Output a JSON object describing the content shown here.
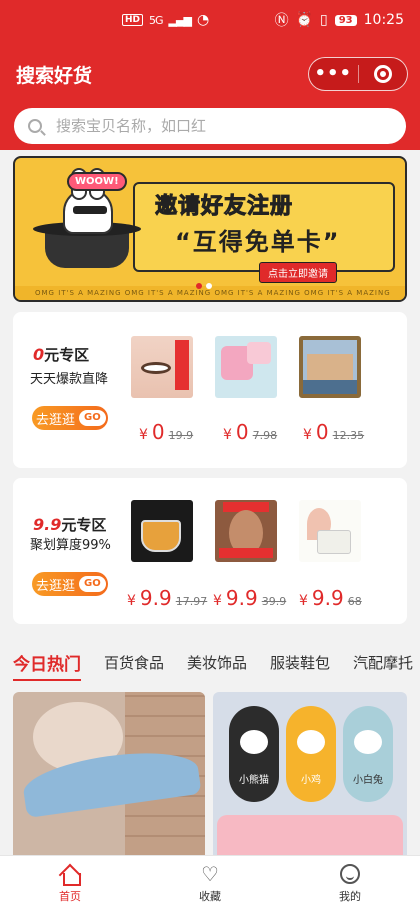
{
  "status_bar": {
    "hd": "HD",
    "network": "5G",
    "battery": "93",
    "time": "10:25"
  },
  "header": {
    "title": "搜索好货",
    "capsule_more": "•••"
  },
  "search": {
    "placeholder": "搜索宝贝名称，如口红"
  },
  "banner": {
    "badge": "WOOW!",
    "line1": "邀请好友注册",
    "line2": "“互得免单卡”",
    "button": "点击立即邀请",
    "strip": "OMG IT'S A MAZING   OMG IT'S A MAZING   OMG IT'S A MAZING   OMG IT'S A MAZING",
    "slide_count": 2,
    "active_slide": 1
  },
  "zero_zone": {
    "title_red": "0",
    "title": "元专区",
    "subtitle": "天天爆款直降",
    "button": "去逛逛",
    "button_badge": "GO",
    "products": [
      {
        "image": "eye-patch-product",
        "currency": "¥",
        "price": "0",
        "original": "19.9"
      },
      {
        "image": "pink-cosmetic-product",
        "currency": "¥",
        "price": "0",
        "original": "7.98"
      },
      {
        "image": "framed-painting-product",
        "currency": "¥",
        "price": "0",
        "original": "12.35"
      }
    ]
  },
  "nine_zone": {
    "title_red": "9.9",
    "title": "元专区",
    "subtitle": "聚划算度99%",
    "button": "去逛逛",
    "button_badge": "GO",
    "products": [
      {
        "image": "glass-tea-cup-product",
        "currency": "¥",
        "price": "9.9",
        "original": "17.97"
      },
      {
        "image": "face-skin-product",
        "currency": "¥",
        "price": "9.9",
        "original": "39.9"
      },
      {
        "image": "cream-jar-product",
        "currency": "¥",
        "price": "9.9",
        "original": "68"
      }
    ]
  },
  "tabs": [
    {
      "label": "今日热门",
      "active": true
    },
    {
      "label": "百货食品",
      "active": false
    },
    {
      "label": "美妆饰品",
      "active": false
    },
    {
      "label": "服装鞋包",
      "active": false
    },
    {
      "label": "汽配摩托",
      "active": false
    }
  ],
  "feed": {
    "item1": {
      "image": "child-shower-cap-photo"
    },
    "item2": {
      "image": "cartoon-cups-photo",
      "labels": [
        "小熊猫",
        "小鸡",
        "小白兔"
      ]
    }
  },
  "bottom_nav": [
    {
      "label": "首页",
      "icon": "home-icon",
      "active": true
    },
    {
      "label": "收藏",
      "icon": "heart-icon",
      "active": false
    },
    {
      "label": "我的",
      "icon": "user-icon",
      "active": false
    }
  ],
  "colors": {
    "brand": "#e02a2a",
    "go_button": "#f46b1c",
    "banner": "#f6c23a"
  }
}
